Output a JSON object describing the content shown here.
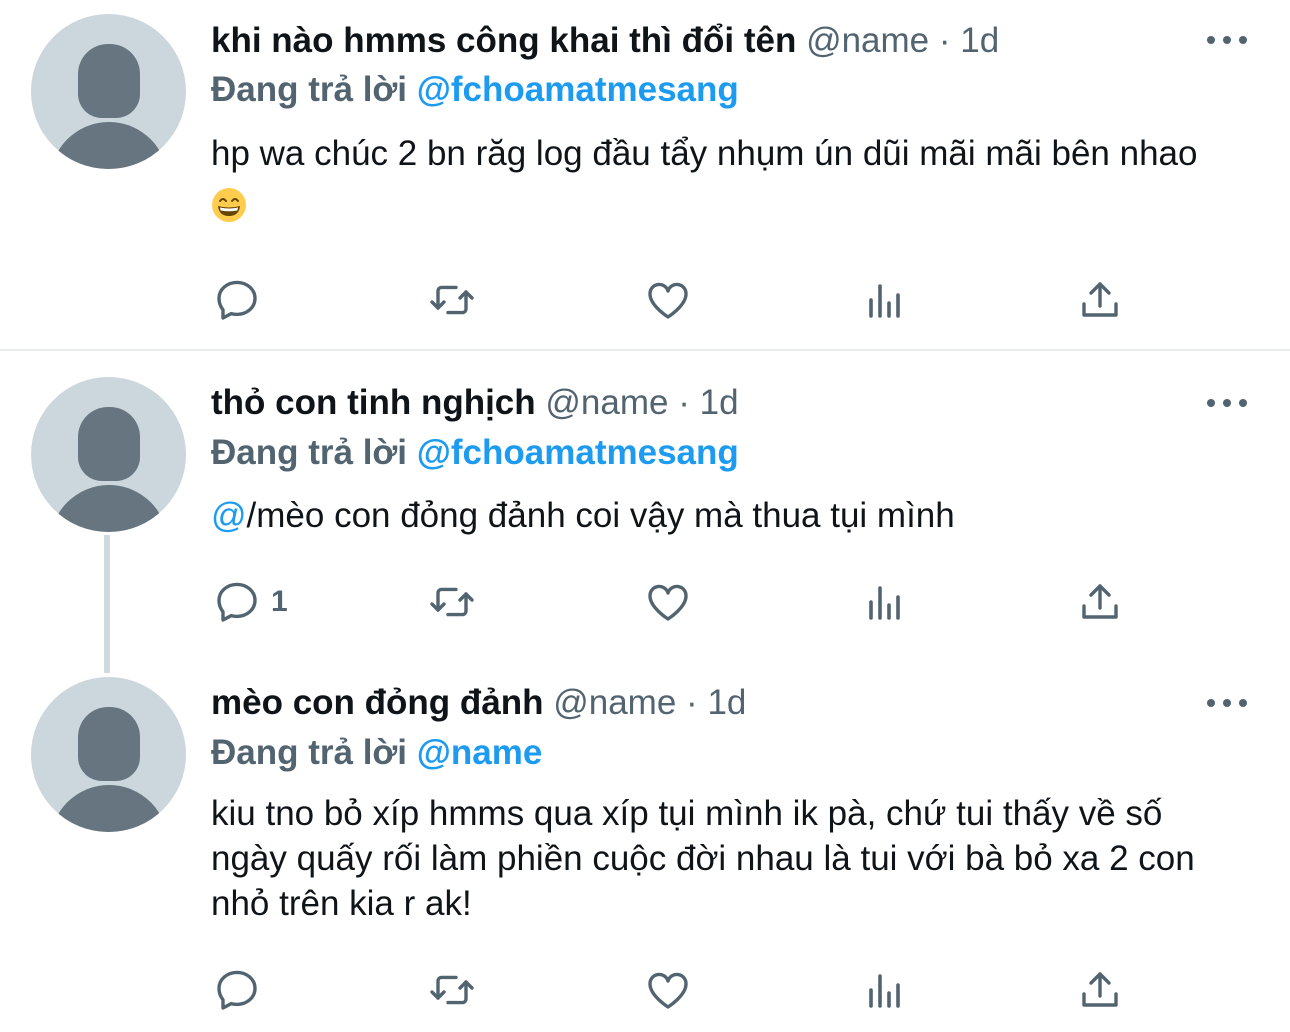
{
  "tweets": [
    {
      "name": "khi nào hmms công khai thì đổi tên",
      "handle": "@name",
      "dot": "·",
      "time": "1d",
      "reply_prefix": "Đang trả lời",
      "reply_to": "@fchoamatmesang",
      "text": "hp wa chúc 2 bn răg log đầu tẩy nhụm ún dũi mãi mãi bên nhao",
      "emoji": "grinning-face-with-smiling-eyes",
      "reply_count": ""
    },
    {
      "name": "thỏ con tinh nghịch",
      "handle": "@name",
      "dot": "·",
      "time": "1d",
      "reply_prefix": "Đang trả lời",
      "reply_to": "@fchoamatmesang",
      "text_mention": "@",
      "text": "/mèo con đỏng đảnh coi vậy mà thua tụi mình",
      "reply_count": "1"
    },
    {
      "name": "mèo con đỏng đảnh",
      "handle": "@name",
      "dot": "·",
      "time": "1d",
      "reply_prefix": "Đang trả lời",
      "reply_to": "@name",
      "text": "kiu tno bỏ xíp hmms qua xíp tụi mình ik pà, chứ tui thấy về số ngày quấy rối làm phiền cuộc đời nhau là tui với bà bỏ xa 2 con nhỏ trên kia r ak!",
      "reply_count": ""
    }
  ],
  "icons": {
    "reply": "reply-icon",
    "retweet": "retweet-icon",
    "like": "like-icon",
    "analytics": "analytics-icon",
    "share": "share-icon",
    "more": "more-icon"
  },
  "colors": {
    "accent": "#1d9bf0",
    "secondary_text": "#536471",
    "avatar_bg": "#ccd6dd",
    "avatar_fg": "#66757f"
  }
}
